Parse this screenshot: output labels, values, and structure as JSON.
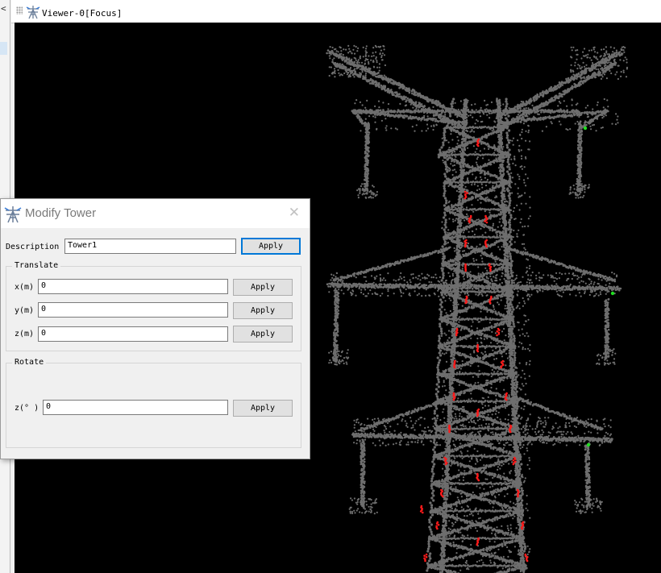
{
  "viewer": {
    "tab_title": "Viewer-0[Focus]",
    "collapse_arrow": "<",
    "background_color": "#000000",
    "cloud_color": "#6e6e6e",
    "highlight_color": "#ff1a1a",
    "marker_color": "#22dd22"
  },
  "dialog": {
    "title": "Modify Tower",
    "close_glyph": "✕",
    "description_label": "Description",
    "description_value": "Tower1",
    "description_apply": "Apply",
    "translate_title": "Translate",
    "x_label": "x(m)",
    "x_value": "0",
    "x_apply": "Apply",
    "y_label": "y(m)",
    "y_value": "0",
    "y_apply": "Apply",
    "z_label": "z(m)",
    "z_value": "0",
    "z_apply": "Apply",
    "rotate_title": "Rotate",
    "rz_label": "z(° )",
    "rz_value": "0",
    "rz_apply": "Apply"
  }
}
